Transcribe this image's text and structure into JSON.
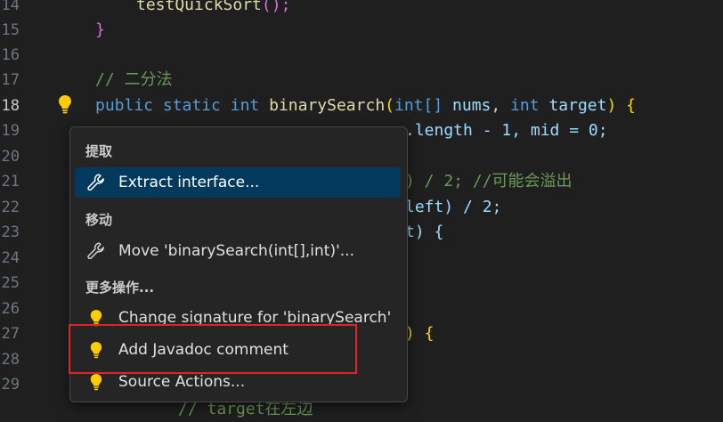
{
  "gutter": {
    "lines": [
      "14",
      "15",
      "16",
      "17",
      "18",
      "19",
      "20",
      "21",
      "22",
      "23",
      "24",
      "25",
      "26",
      "27",
      "28",
      "29"
    ]
  },
  "code": {
    "l14_fn": "testQuickSort",
    "l14_rest": "();",
    "l15": "}",
    "l17": "// 二分法",
    "l18_public": "public",
    "l18_static": "static",
    "l18_int": "int",
    "l18_name": "binarySearch",
    "l18_type": "int[]",
    "l18_nums": "nums",
    "l18_int2": "int",
    "l18_target": "target",
    "l18_end": "{",
    "l19_tail": ".length - 1, mid = 0;",
    "l21_tail": ") / 2; //可能会溢出",
    "l22_tail": "left) / 2;",
    "l23_tail": "t) {",
    "l27_tail": ") {",
    "l30": "// target在左边"
  },
  "menu": {
    "sections": [
      {
        "title": "提取"
      },
      {
        "title": "移动"
      },
      {
        "title": "更多操作..."
      }
    ],
    "items": [
      {
        "label": "Extract interface...",
        "icon": "wrench-icon",
        "selected": true
      },
      {
        "label": "Move 'binarySearch(int[],int)'...",
        "icon": "wrench-icon"
      },
      {
        "label": "Change signature for 'binarySearch'",
        "icon": "lightbulb-icon"
      },
      {
        "label": "Add Javadoc comment",
        "icon": "lightbulb-icon"
      },
      {
        "label": "Source Actions...",
        "icon": "lightbulb-icon"
      }
    ]
  },
  "colors": {
    "accent_selected": "#04395e",
    "bulb": "#ffcc00",
    "highlight_box": "#e02424"
  }
}
